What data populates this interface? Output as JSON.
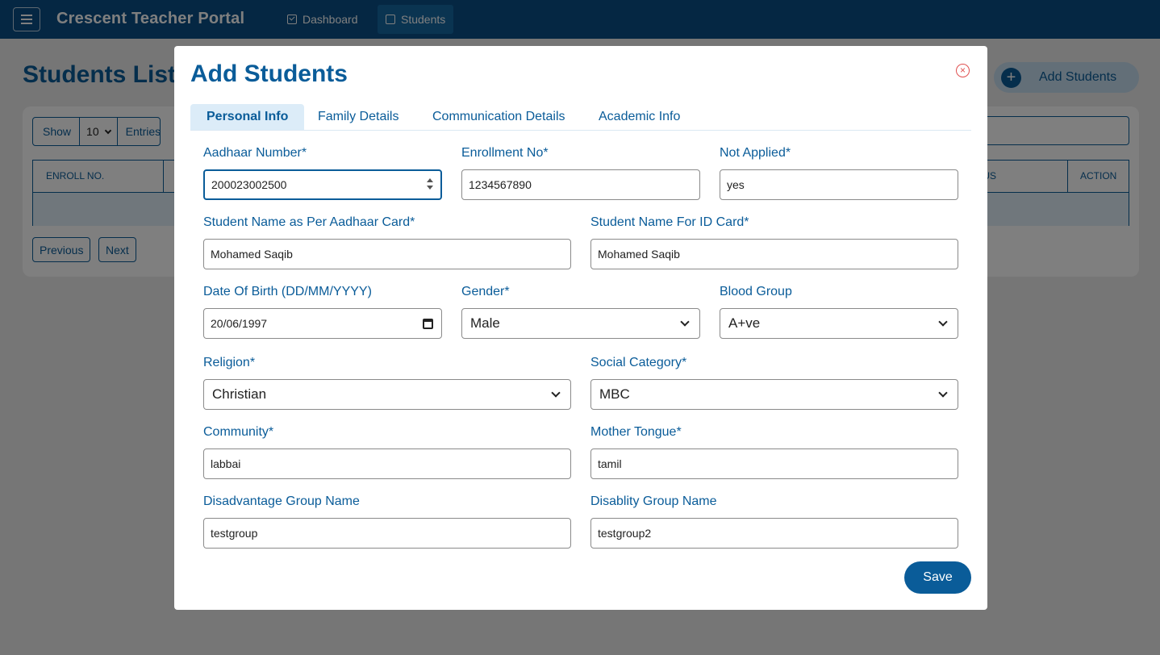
{
  "app": {
    "brand": "Crescent Teacher Portal",
    "nav": [
      {
        "label": "Dashboard"
      },
      {
        "label": "Students"
      }
    ]
  },
  "page": {
    "title": "Students List",
    "add_button": "Add Students",
    "show_label": "Show",
    "entries_value": "10",
    "entries_label": "Entries",
    "table_headers": [
      "ENROLL NO.",
      "TUS",
      "ACTION"
    ],
    "prev_label": "Previous",
    "next_label": "Next"
  },
  "modal": {
    "title": "Add Students",
    "close_icon": "×",
    "tabs": [
      {
        "label": "Personal Info"
      },
      {
        "label": "Family Details"
      },
      {
        "label": "Communication Details"
      },
      {
        "label": "Academic Info"
      }
    ],
    "fields": {
      "aadhaar": {
        "label": "Aadhaar Number*",
        "value": "200023002500"
      },
      "enrollment": {
        "label": "Enrollment No*",
        "value": "1234567890"
      },
      "not_applied": {
        "label": "Not Applied*",
        "value": "yes"
      },
      "name_aadhaar": {
        "label": "Student Name as Per Aadhaar Card*",
        "value": "Mohamed Saqib"
      },
      "name_id": {
        "label": "Student Name For ID Card*",
        "value": "Mohamed Saqib"
      },
      "dob": {
        "label": "Date Of Birth (DD/MM/YYYY)",
        "value": "20/06/1997"
      },
      "gender": {
        "label": "Gender*",
        "value": "Male"
      },
      "blood_group": {
        "label": "Blood Group",
        "value": "A+ve"
      },
      "religion": {
        "label": "Religion*",
        "value": "Christian"
      },
      "social_category": {
        "label": "Social Category*",
        "value": "MBC"
      },
      "community": {
        "label": "Community*",
        "value": "labbai"
      },
      "mother_tongue": {
        "label": "Mother Tongue*",
        "value": "tamil"
      },
      "disadvantage_group": {
        "label": "Disadvantage Group Name",
        "value": "testgroup"
      },
      "disability_group": {
        "label": "Disablity Group Name",
        "value": "testgroup2"
      }
    },
    "save_label": "Save"
  }
}
